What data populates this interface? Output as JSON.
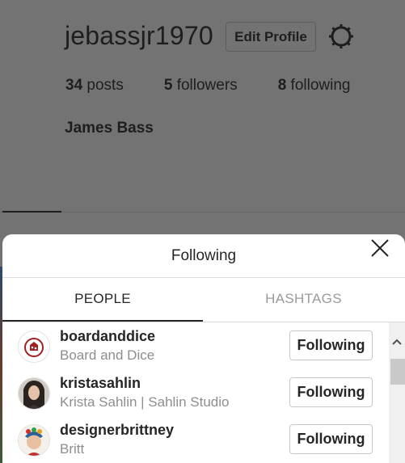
{
  "profile": {
    "username": "jebassjr1970",
    "edit_profile_label": "Edit Profile",
    "settings_icon": "gear-icon",
    "stats": {
      "posts_count": "34",
      "posts_label": "posts",
      "followers_count": "5",
      "followers_label": "followers",
      "following_count": "8",
      "following_label": "following"
    },
    "full_name": "James Bass"
  },
  "modal": {
    "title": "Following",
    "close_icon": "close-icon",
    "tabs": [
      {
        "label": "PEOPLE",
        "active": true
      },
      {
        "label": "HASHTAGS",
        "active": false
      }
    ],
    "people": [
      {
        "username": "boardanddice",
        "display_name": "Board and Dice",
        "button_label": "Following",
        "avatar": "board-and-dice-logo"
      },
      {
        "username": "kristasahlin",
        "display_name": "Krista Sahlin | Sahlin Studio",
        "button_label": "Following",
        "avatar": "person-photo"
      },
      {
        "username": "designerbrittney",
        "display_name": "Britt",
        "button_label": "Following",
        "avatar": "person-photo"
      }
    ]
  },
  "colors": {
    "overlay_background": "#737373",
    "modal_background": "#ffffff",
    "secondary_text": "#8e8e8e"
  }
}
